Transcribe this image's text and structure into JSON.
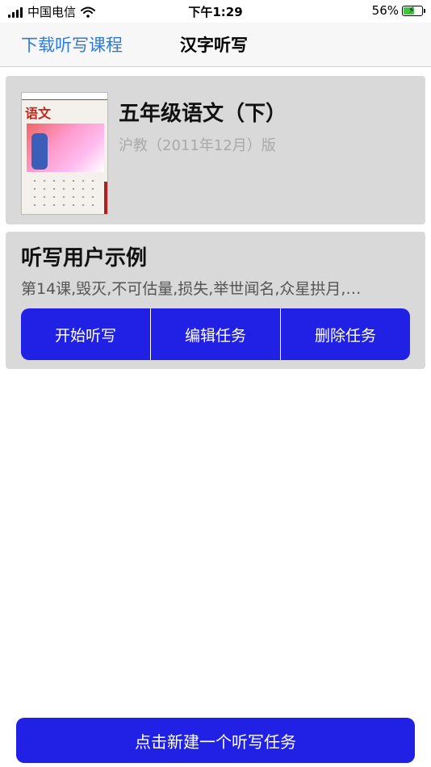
{
  "status_bar": {
    "carrier": "中国电信",
    "time": "下午1:29",
    "battery_percent": "56%",
    "battery_level": 0.56,
    "icons": [
      "signal-icon",
      "wifi-icon",
      "battery-charging-icon"
    ]
  },
  "nav": {
    "left_link": "下载听写课程",
    "title": "汉字听写"
  },
  "book": {
    "cover_title": "语文",
    "title": "五年级语文（下）",
    "edition": "沪教（2011年12月）版"
  },
  "task": {
    "title": "听写用户示例",
    "words": "第14课,毁灭,不可估量,损失,举世闻名,众星拱月,…",
    "buttons": {
      "start": "开始听写",
      "edit": "编辑任务",
      "delete": "删除任务"
    }
  },
  "footer": {
    "new_task": "点击新建一个听写任务"
  },
  "colors": {
    "accent_link": "#2f7bd8",
    "primary_button": "#2121e5",
    "card_bg": "#d9d9d9"
  }
}
